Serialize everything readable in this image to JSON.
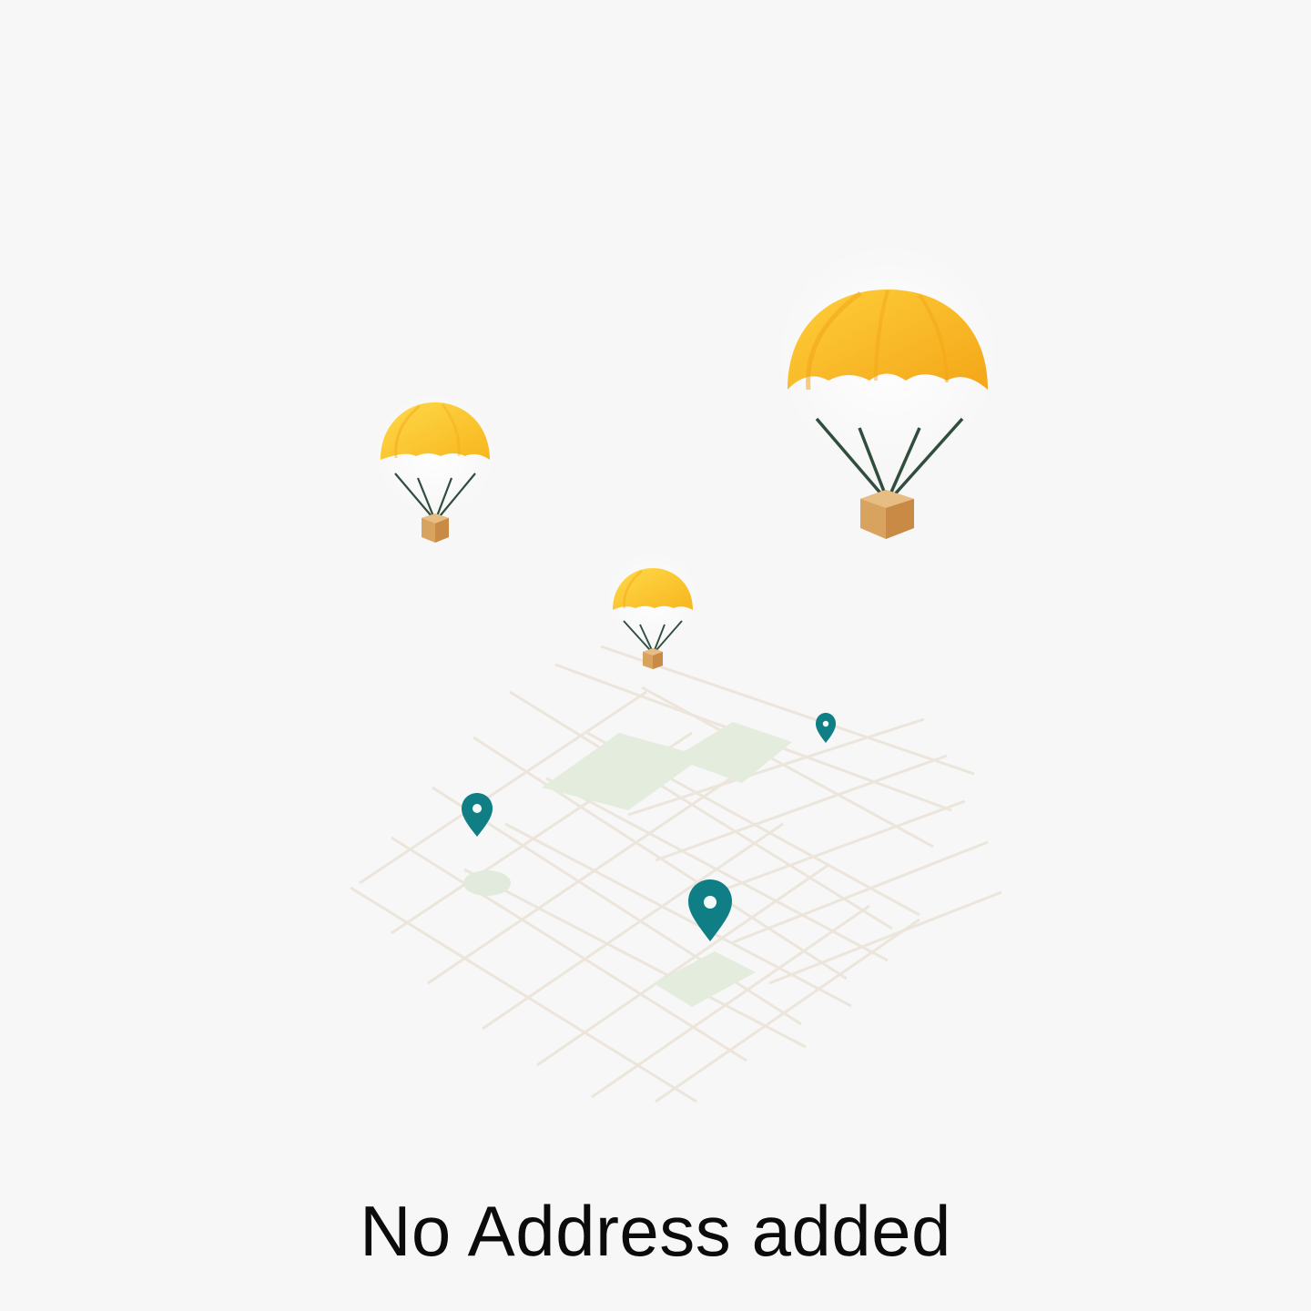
{
  "empty_state": {
    "title": "No Address added",
    "illustration": {
      "name": "parachute-delivery-map-illustration",
      "icons": [
        "parachute-icon",
        "package-icon",
        "map-pin-icon"
      ],
      "colors": {
        "background": "#f7f7f7",
        "canopy": "#ffc61a",
        "canopy_shadow": "#f2a516",
        "box": "#d8a25f",
        "pin": "#0f7f85",
        "map_block": "#e3ecdd",
        "grid": "#e9e3d7"
      }
    }
  }
}
